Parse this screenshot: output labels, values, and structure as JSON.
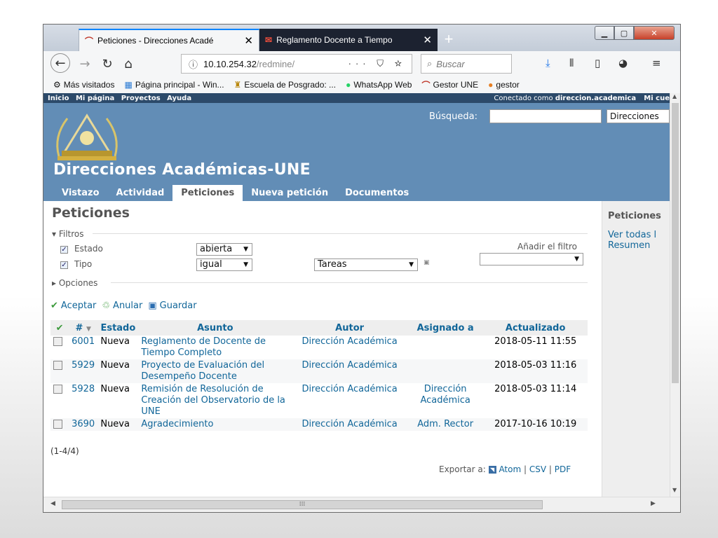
{
  "browser": {
    "tabs": [
      {
        "title": "Peticiones - Direcciones Acadé",
        "close": "✕"
      },
      {
        "title": "Reglamento Docente a Tiempo",
        "close": "✕"
      }
    ],
    "new_tab": "+",
    "url_info": "ⓘ",
    "url_host": "10.10.254.32",
    "url_path": "/redmine/",
    "url_actions": "··· ⛉ ☆",
    "search_placeholder": "Buscar",
    "bookmarks": [
      {
        "icon": "⚙",
        "label": "Más visitados"
      },
      {
        "icon": "▦",
        "label": "Página principal - Win..."
      },
      {
        "icon": "♜",
        "label": "Escuela de Posgrado: ..."
      },
      {
        "icon": "●",
        "label": "WhatsApp Web"
      },
      {
        "icon": "⌒",
        "label": "Gestor UNE"
      },
      {
        "icon": "●",
        "label": "gestor"
      }
    ]
  },
  "redmine": {
    "top_menu": [
      "Inicio",
      "Mi página",
      "Proyectos",
      "Ayuda"
    ],
    "logged_prefix": "Conectado como",
    "logged_user": "direccion.academica",
    "my_account": "Mi cue",
    "search_label": "Búsqueda:",
    "project_select": "Direcciones",
    "project_title": "Direcciones Académicas-UNE",
    "main_menu": [
      "Vistazo",
      "Actividad",
      "Peticiones",
      "Nueva petición",
      "Documentos"
    ],
    "page_title": "Peticiones",
    "filters_legend": "Filtros",
    "filters": [
      {
        "label": "Estado",
        "operator": "abierta"
      },
      {
        "label": "Tipo",
        "operator": "igual",
        "value": "Tareas"
      }
    ],
    "add_filter_label": "Añadir el filtro",
    "options_legend": "Opciones",
    "actions": {
      "apply": "Aceptar",
      "clear": "Anular",
      "save": "Guardar"
    },
    "columns": [
      "#",
      "Estado",
      "Asunto",
      "Autor",
      "Asignado a",
      "Actualizado"
    ],
    "issues": [
      {
        "id": "6001",
        "status": "Nueva",
        "subject": "Reglamento de Docente de Tiempo Completo",
        "author": "Dirección Académica",
        "assigned": "",
        "updated": "2018-05-11 11:55"
      },
      {
        "id": "5929",
        "status": "Nueva",
        "subject": "Proyecto de Evaluación del Desempeño Docente",
        "author": "Dirección Académica",
        "assigned": "",
        "updated": "2018-05-03 11:16"
      },
      {
        "id": "5928",
        "status": "Nueva",
        "subject": "Remisión de Resolución de Creación del Observatorio de la UNE",
        "author": "Dirección Académica",
        "assigned": "Dirección Académica",
        "updated": "2018-05-03 11:14"
      },
      {
        "id": "3690",
        "status": "Nueva",
        "subject": "Agradecimiento",
        "author": "Dirección Académica",
        "assigned": "Adm. Rector",
        "updated": "2017-10-16 10:19"
      }
    ],
    "pagination": "(1-4/4)",
    "export_label": "Exportar a:",
    "export_formats": [
      "Atom",
      "CSV",
      "PDF"
    ],
    "sidebar": {
      "title": "Peticiones",
      "links": [
        "Ver todas l",
        "Resumen"
      ]
    }
  },
  "colors": {
    "header": "#628db6",
    "top_menu": "#2c4a6a",
    "link": "#116699"
  }
}
